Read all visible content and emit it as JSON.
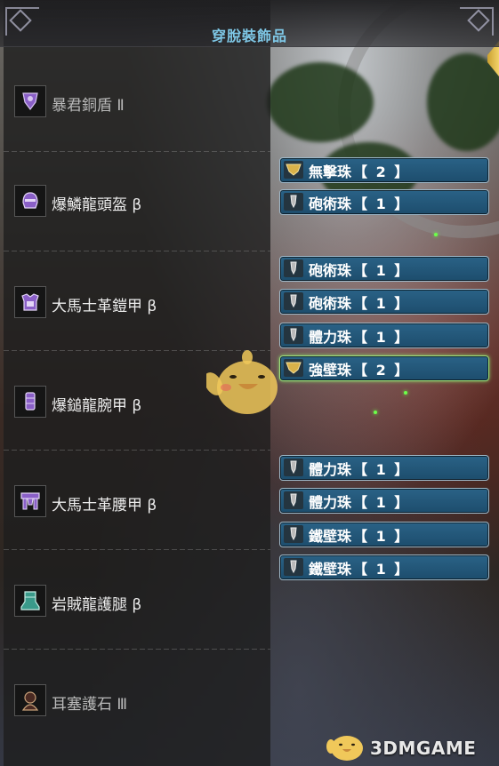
{
  "title": "穿脫裝飾品",
  "equipment": [
    {
      "name": "暴君銅盾 Ⅱ",
      "icon": "weapon-shield-icon",
      "dim": true
    },
    {
      "name": "爆鱗龍頭盔 β",
      "icon": "helmet-icon"
    },
    {
      "name": "大馬士革鎧甲 β",
      "icon": "chest-armor-icon"
    },
    {
      "name": "爆鎚龍腕甲 β",
      "icon": "arm-armor-icon"
    },
    {
      "name": "大馬士革腰甲 β",
      "icon": "waist-armor-icon"
    },
    {
      "name": "岩賊龍護腿 β",
      "icon": "leg-armor-icon"
    },
    {
      "name": "耳塞護石 Ⅲ",
      "icon": "charm-icon"
    }
  ],
  "decorations": [
    {
      "name": "無擊珠",
      "level": "【 2 】",
      "slot": 2
    },
    {
      "name": "砲術珠",
      "level": "【 1 】",
      "slot": 1
    },
    {
      "name": "砲術珠",
      "level": "【 1 】",
      "slot": 1
    },
    {
      "name": "砲術珠",
      "level": "【 1 】",
      "slot": 1
    },
    {
      "name": "體力珠",
      "level": "【 1 】",
      "slot": 1
    },
    {
      "name": "強壁珠",
      "level": "【 2 】",
      "slot": 2,
      "selected": true
    },
    {
      "name": "體力珠",
      "level": "【 1 】",
      "slot": 1
    },
    {
      "name": "體力珠",
      "level": "【 1 】",
      "slot": 1
    },
    {
      "name": "鐵壁珠",
      "level": "【 1 】",
      "slot": 1
    },
    {
      "name": "鐵壁珠",
      "level": "【 1 】",
      "slot": 1
    }
  ],
  "watermark": {
    "text": "3DMGAME"
  },
  "colors": {
    "title": "#7ec7e6",
    "deco_bg": "#1d4d6d",
    "selected_border": "#9ee07a"
  }
}
